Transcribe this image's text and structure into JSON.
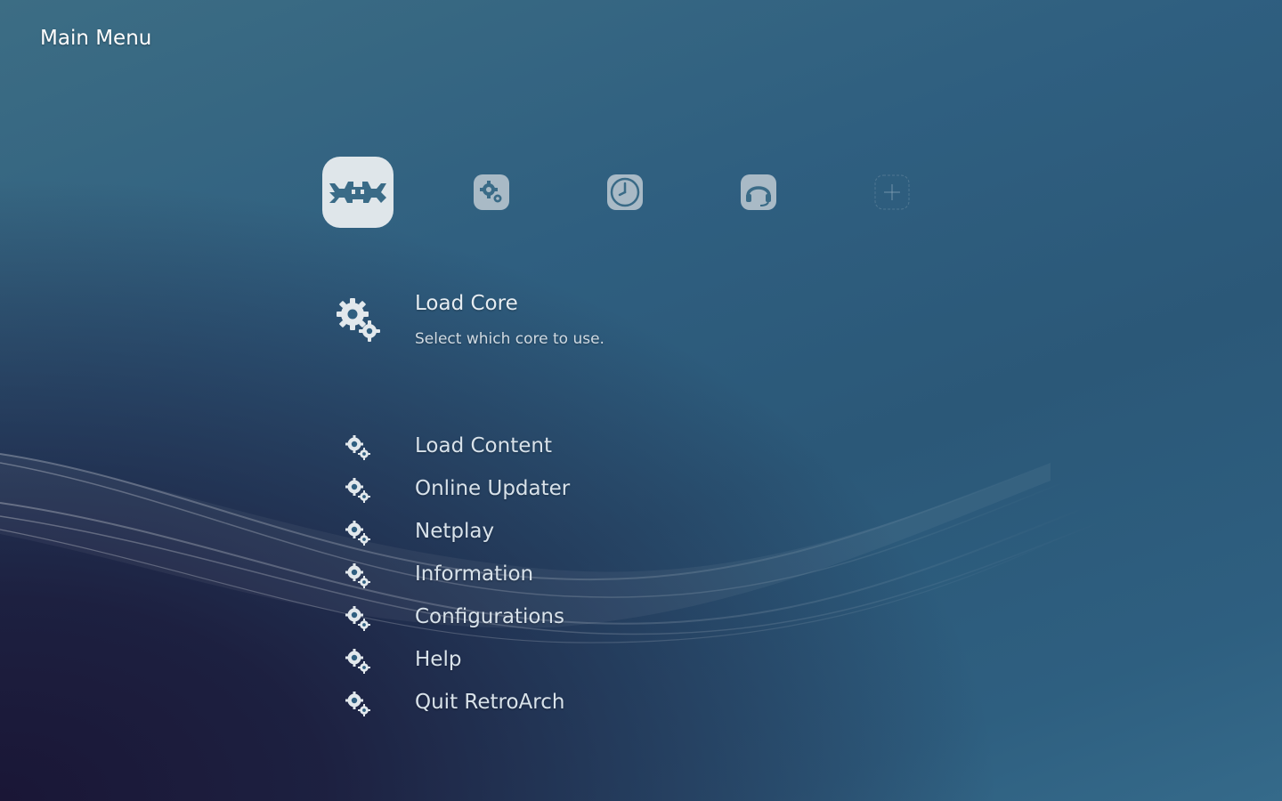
{
  "header": {
    "title": "Main Menu"
  },
  "tabs": [
    {
      "name": "main-menu-tab",
      "icon": "retroarch-invader-icon",
      "selected": true
    },
    {
      "name": "settings-tab",
      "icon": "gears-icon",
      "selected": false
    },
    {
      "name": "history-tab",
      "icon": "clock-icon",
      "selected": false
    },
    {
      "name": "netplay-tab",
      "icon": "headset-icon",
      "selected": false
    },
    {
      "name": "add-tab",
      "icon": "plus-icon",
      "selected": false
    }
  ],
  "menu": {
    "selected": {
      "label": "Load Core",
      "sublabel": "Select which core to use.",
      "icon": "gears-icon"
    },
    "items": [
      {
        "label": "Load Content",
        "icon": "gears-icon"
      },
      {
        "label": "Online Updater",
        "icon": "gears-icon"
      },
      {
        "label": "Netplay",
        "icon": "gears-icon"
      },
      {
        "label": "Information",
        "icon": "gears-icon"
      },
      {
        "label": "Configurations",
        "icon": "gears-icon"
      },
      {
        "label": "Help",
        "icon": "gears-icon"
      },
      {
        "label": "Quit RetroArch",
        "icon": "gears-icon"
      }
    ]
  },
  "colors": {
    "icon_fill": "#e2e8ec",
    "tab_icon_fill": "#a9bac6",
    "background_top": "#3c6d84",
    "background_bottom_left": "#1a1636"
  }
}
